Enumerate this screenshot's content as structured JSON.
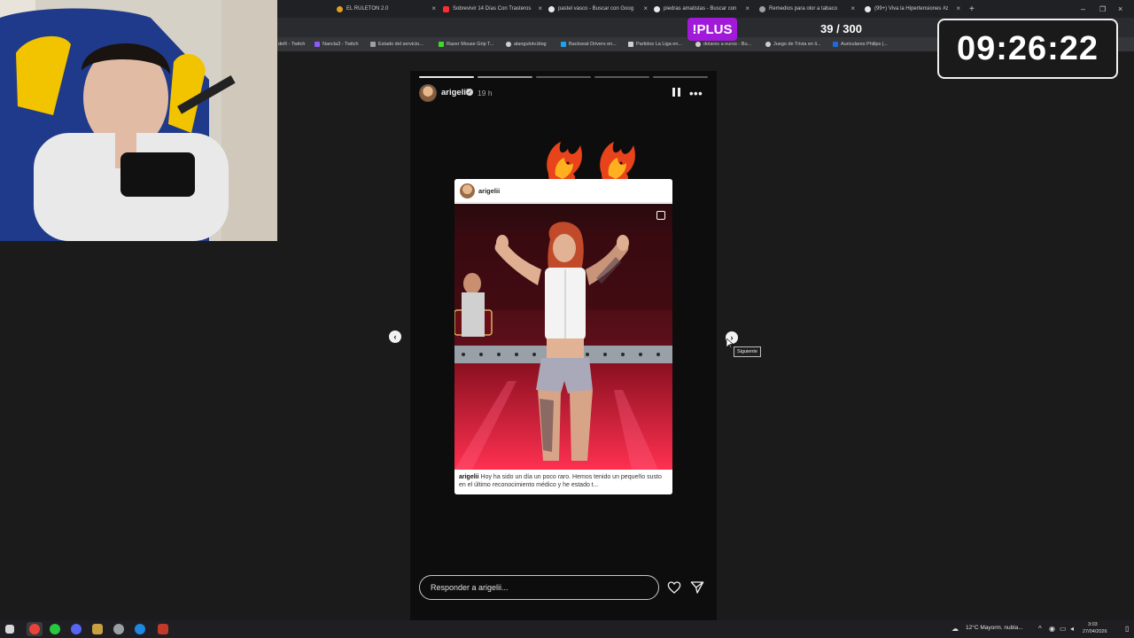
{
  "browser": {
    "tabs": [
      {
        "label": "EL RULETON 2.0",
        "color": "#e0a020"
      },
      {
        "label": "Sobrevivir 14 Días Con Trasteros",
        "color": "#ff2d2d"
      },
      {
        "label": "pastel vasco - Buscar con Goog",
        "color": "#e8e8e8"
      },
      {
        "label": "piedras amatistas - Buscar con",
        "color": "#e8e8e8"
      },
      {
        "label": "Remedios para olor a tabaco",
        "color": "#9aa0a6"
      },
      {
        "label": "(99+) Viva la Hipertensiones #z",
        "color": "#e8e8e8"
      }
    ],
    "bookmarks": [
      {
        "label": "deR - Twitch",
        "color": "#8a5cf6"
      },
      {
        "label": "Nancla3 - Twitch",
        "color": "#8a5cf6"
      },
      {
        "label": "Estado del servicio...",
        "color": "#9aa0a6"
      },
      {
        "label": "Razer Mouse Grip T...",
        "color": "#44d62c"
      },
      {
        "label": "alangulotv.blog",
        "color": "#cfcfcf"
      },
      {
        "label": "Backseat Drivers en...",
        "color": "#1da1f2"
      },
      {
        "label": "Partidos La Liga en...",
        "color": "#cfcfcf"
      },
      {
        "label": "dolares a euros - Bu...",
        "color": "#cfcfcf"
      },
      {
        "label": "Juego de Trivia en li...",
        "color": "#cfcfcf"
      },
      {
        "label": "Auriculares Philips |...",
        "color": "#1e6ad6"
      }
    ]
  },
  "overlay": {
    "plus_label": "!PLUS",
    "plus_count": "39 / 300",
    "timer": "09:26:22"
  },
  "story": {
    "username": "arigelii",
    "time_ago": "19 h",
    "progress_segments": 5,
    "progress_done": 1,
    "post": {
      "username": "arigelii",
      "caption_user": "arigelii",
      "caption_text": "Hoy ha sido un día un poco raro. Hemos tenido un pequeño susto en el último reconocimiento médico y he estado t..."
    },
    "reply_placeholder": "Responder a arigelii..."
  },
  "nav": {
    "prev_arrow": "‹",
    "next_arrow": "›",
    "tooltip": "Siguiente"
  },
  "taskbar": {
    "weather": "12°C  Mayorm. nubla...",
    "time": "3:03",
    "date": "27/04/2026"
  }
}
